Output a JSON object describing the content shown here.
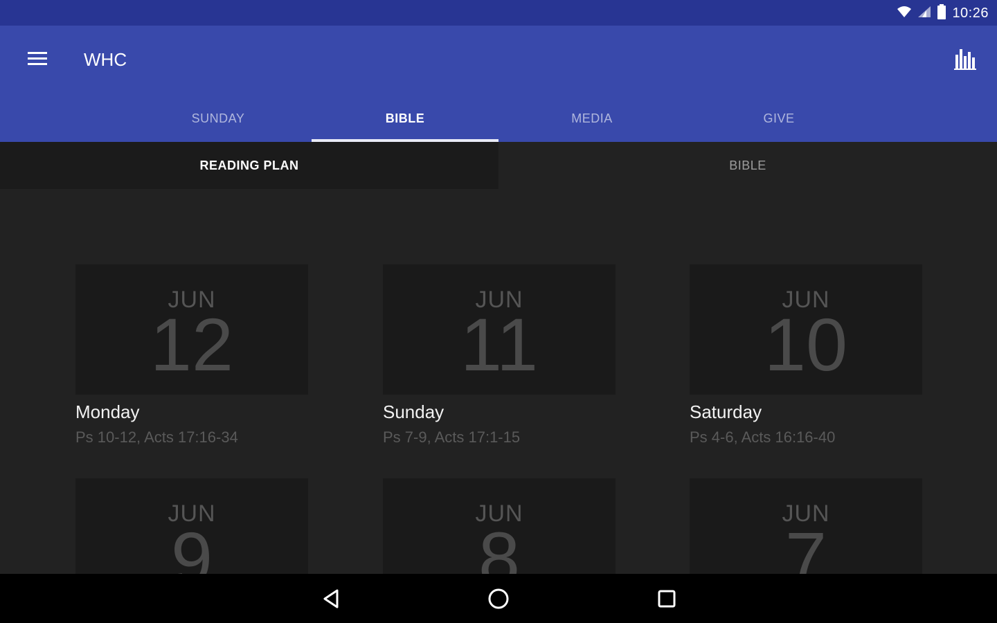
{
  "status": {
    "time": "10:26"
  },
  "appbar": {
    "title": "WHC"
  },
  "tabs": [
    {
      "label": "SUNDAY",
      "active": false
    },
    {
      "label": "BIBLE",
      "active": true
    },
    {
      "label": "MEDIA",
      "active": false
    },
    {
      "label": "GIVE",
      "active": false
    }
  ],
  "subtabs": [
    {
      "label": "READING PLAN",
      "active": true
    },
    {
      "label": "BIBLE",
      "active": false
    }
  ],
  "days": [
    {
      "month": "JUN",
      "day": "12",
      "weekday": "Monday",
      "reading": "Ps 10-12, Acts 17:16-34"
    },
    {
      "month": "JUN",
      "day": "11",
      "weekday": "Sunday",
      "reading": "Ps 7-9, Acts 17:1-15"
    },
    {
      "month": "JUN",
      "day": "10",
      "weekday": "Saturday",
      "reading": "Ps 4-6, Acts 16:16-40"
    },
    {
      "month": "JUN",
      "day": "9"
    },
    {
      "month": "JUN",
      "day": "8"
    },
    {
      "month": "JUN",
      "day": "7"
    }
  ],
  "colors": {
    "primary": "#3949ab",
    "primary_dark": "#283593",
    "background": "#222222"
  }
}
